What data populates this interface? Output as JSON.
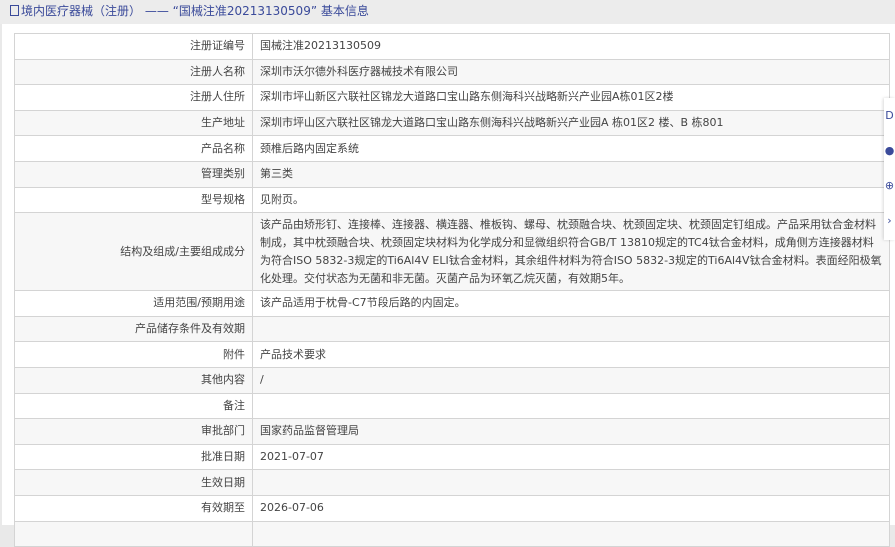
{
  "header": {
    "title": "境内医疗器械（注册） —— “国械注准20213130509” 基本信息"
  },
  "rows": [
    {
      "label": "注册证编号",
      "value": "国械注准20213130509"
    },
    {
      "label": "注册人名称",
      "value": "深圳市沃尔德外科医疗器械技术有限公司"
    },
    {
      "label": "注册人住所",
      "value": "深圳市坪山新区六联社区锦龙大道路口宝山路东侧海科兴战略新兴产业园A栋01区2楼"
    },
    {
      "label": "生产地址",
      "value": "深圳市坪山区六联社区锦龙大道路口宝山路东侧海科兴战略新兴产业园A 栋01区2 楼、B 栋801"
    },
    {
      "label": "产品名称",
      "value": "颈椎后路内固定系统"
    },
    {
      "label": "管理类别",
      "value": "第三类"
    },
    {
      "label": "型号规格",
      "value": "见附页。"
    },
    {
      "label": "结构及组成/主要组成成分",
      "value": "该产品由矫形钉、连接棒、连接器、横连器、椎板钩、螺母、枕颈融合块、枕颈固定块、枕颈固定钉组成。产品采用钛合金材料制成，其中枕颈融合块、枕颈固定块材料为化学成分和显微组织符合GB/T 13810规定的TC4钛合金材料，成角侧方连接器材料为符合ISO 5832-3规定的Ti6Al4V ELI钛合金材料，其余组件材料为符合ISO 5832-3规定的Ti6Al4V钛合金材料。表面经阳极氧化处理。交付状态为无菌和非无菌。灭菌产品为环氧乙烷灭菌，有效期5年。"
    },
    {
      "label": "适用范围/预期用途",
      "value": "该产品适用于枕骨-C7节段后路的内固定。"
    },
    {
      "label": "产品储存条件及有效期",
      "value": ""
    },
    {
      "label": "附件",
      "value": "产品技术要求"
    },
    {
      "label": "其他内容",
      "value": "/"
    },
    {
      "label": "备注",
      "value": ""
    },
    {
      "label": "审批部门",
      "value": "国家药品监督管理局"
    },
    {
      "label": "批准日期",
      "value": "2021-07-07"
    },
    {
      "label": "生效日期",
      "value": ""
    },
    {
      "label": "有效期至",
      "value": "2026-07-06"
    },
    {
      "label": "",
      "value": ""
    }
  ],
  "float": [
    "D",
    "●",
    "⊕",
    "›"
  ]
}
